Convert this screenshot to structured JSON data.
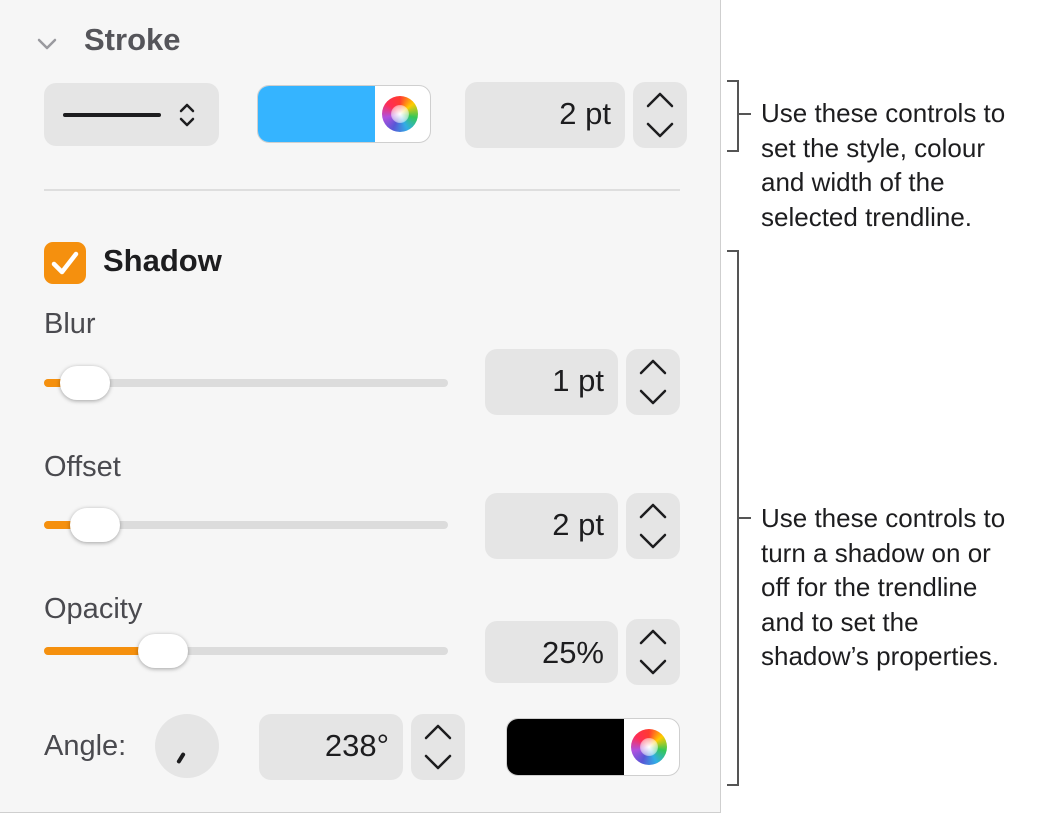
{
  "stroke": {
    "title": "Stroke",
    "line_style_icon": "solid-line-icon",
    "color": "#35b4ff",
    "width_value": "2 pt"
  },
  "shadow": {
    "title": "Shadow",
    "enabled": true,
    "blur": {
      "label": "Blur",
      "value": "1 pt",
      "level": 0.03
    },
    "offset": {
      "label": "Offset",
      "value": "2 pt",
      "level": 0.06
    },
    "opacity": {
      "label": "Opacity",
      "value": "25%",
      "level": 0.25
    },
    "angle": {
      "label": "Angle:",
      "value": "238°"
    },
    "color": "#000000"
  },
  "accent_color": "#f5900e",
  "callouts": {
    "stroke_note": "Use these controls to set the style, colour and width of the selected trendline.",
    "stroke_lines": [
      "Use these controls to",
      "set the style, colour",
      "and width of the",
      "selected trendline."
    ],
    "shadow_note": "Use these controls to turn a shadow on or off for the trendline and to set the shadow’s properties.",
    "shadow_lines": [
      "Use these controls to",
      "turn a shadow on or",
      "off for the trendline",
      "and to set the",
      "shadow’s properties."
    ]
  }
}
